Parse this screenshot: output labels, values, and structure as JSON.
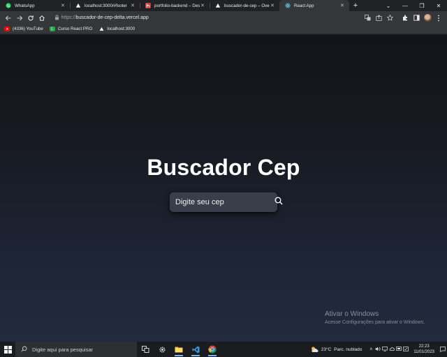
{
  "tabs": [
    {
      "title": "WhatsApp",
      "icon": "whatsapp-icon",
      "color": "#25d366",
      "active": false
    },
    {
      "title": "localhost:3000/#footer",
      "icon": "vercel-triangle-icon",
      "color": "#ffffff",
      "active": false
    },
    {
      "title": "portfolio-backend – Desk",
      "icon": "heroku-icon",
      "color": "#d43f3a",
      "active": false
    },
    {
      "title": "buscador-de-cep – Overv",
      "icon": "vercel-triangle-icon",
      "color": "#ffffff",
      "active": false
    },
    {
      "title": "React App",
      "icon": "react-icon",
      "color": "#61dafb",
      "active": true
    }
  ],
  "new_tab_label": "+",
  "address": {
    "scheme": "https://",
    "host": "buscador-de-cep-delta.vercel.app"
  },
  "bookmarks": [
    {
      "label": "(4336) YouTube",
      "icon": "youtube-icon",
      "color": "#ff0000"
    },
    {
      "label": "Curso React PRO",
      "icon": "course-icon",
      "color": "#2ea44f"
    },
    {
      "label": "localhost:3000",
      "icon": "vercel-triangle-icon",
      "color": "#ffffff"
    }
  ],
  "page": {
    "title": "Buscador Cep",
    "search_placeholder": "Digite seu cep",
    "search_icon": "search-icon"
  },
  "watermark": {
    "line1": "Ativar o Windows",
    "line2": "Acesse Configurações para ativar o Windows."
  },
  "taskbar": {
    "search_placeholder": "Digite aqui para pesquisar",
    "weather_temp": "23°C",
    "weather_desc": "Parc. nublado",
    "time": "22:23",
    "date": "11/01/2023"
  },
  "colors": {
    "accent_blue": "#7fb2f0",
    "bg_top": "#121418",
    "bg_bottom": "#222a3f",
    "search_box": "#3a3e4a"
  }
}
